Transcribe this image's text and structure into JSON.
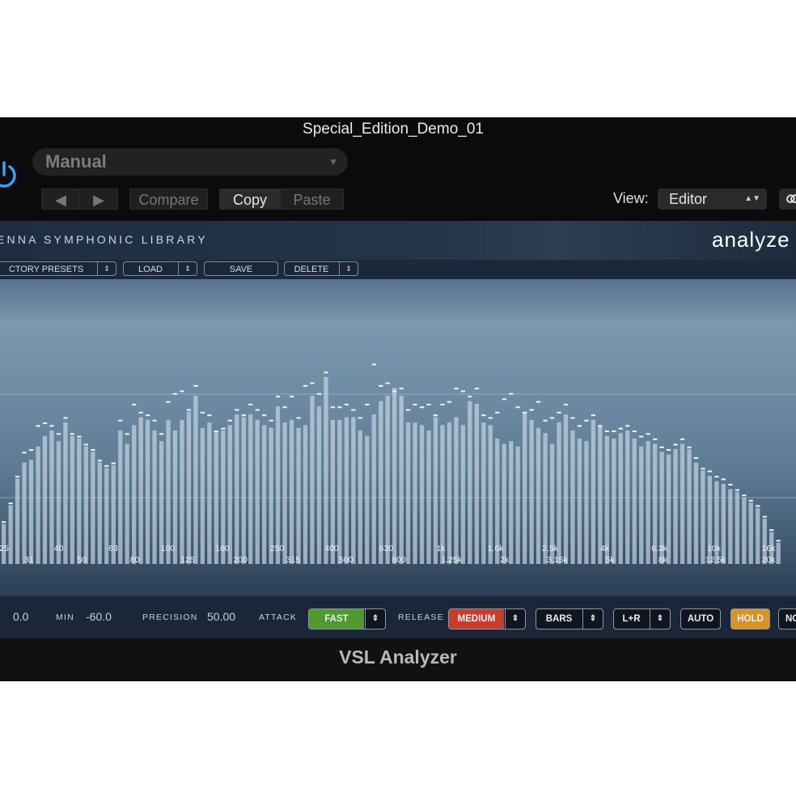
{
  "window": {
    "title": "Special_Edition_Demo_01",
    "footer_title": "VSL Analyzer"
  },
  "header": {
    "preset_value": "Manual",
    "nav_prev": "◀",
    "nav_next": "▶",
    "compare_label": "Compare",
    "copy_label": "Copy",
    "paste_label": "Paste",
    "view_label": "View:",
    "view_value": "Editor"
  },
  "plugin": {
    "brand": "ENNA SYMPHONIC LIBRARY",
    "logo": "analyze",
    "presets": {
      "factory": "CTORY PRESETS",
      "load": "LOAD",
      "save": "SAVE",
      "delete": "DELETE"
    }
  },
  "controls": {
    "max_value": "0.0",
    "min_label": "MIN",
    "min_value": "-60.0",
    "precision_label": "PRECISION",
    "precision_value": "50.00",
    "attack_label": "ATTACK",
    "attack_value": "FAST",
    "release_label": "RELEASE",
    "release_value": "MEDIUM",
    "display_mode": "BARS",
    "channel": "L+R",
    "auto_label": "AUTO",
    "hold_label": "HOLD",
    "last_label": "NO"
  },
  "colors": {
    "attack": "#4f9a30",
    "release": "#c83c2c",
    "hold": "#d59526",
    "power": "#3aa0ff"
  },
  "chart_data": {
    "type": "bar",
    "freq_labels": {
      "upper": [
        "25",
        "40",
        "63",
        "100",
        "160",
        "250",
        "400",
        "630",
        "1k",
        "1.6k",
        "2.5k",
        "4k",
        "6.3k",
        "10k",
        "16k"
      ],
      "lower": [
        "31",
        "50",
        "80",
        "125",
        "200",
        "315",
        "500",
        "800",
        "1.25k",
        "2k",
        "3.15k",
        "5k",
        "8k",
        "12.5k",
        "20k"
      ]
    },
    "ylim": [
      0,
      1
    ],
    "bars": [
      0.15,
      0.22,
      0.32,
      0.38,
      0.39,
      0.44,
      0.48,
      0.5,
      0.46,
      0.53,
      0.48,
      0.47,
      0.44,
      0.42,
      0.38,
      0.36,
      0.37,
      0.5,
      0.45,
      0.52,
      0.55,
      0.54,
      0.5,
      0.46,
      0.54,
      0.5,
      0.54,
      0.57,
      0.63,
      0.51,
      0.53,
      0.5,
      0.5,
      0.52,
      0.56,
      0.55,
      0.56,
      0.54,
      0.52,
      0.51,
      0.59,
      0.53,
      0.54,
      0.51,
      0.52,
      0.63,
      0.59,
      0.7,
      0.54,
      0.54,
      0.55,
      0.55,
      0.5,
      0.48,
      0.56,
      0.61,
      0.63,
      0.66,
      0.63,
      0.53,
      0.53,
      0.52,
      0.5,
      0.55,
      0.52,
      0.53,
      0.55,
      0.52,
      0.61,
      0.6,
      0.53,
      0.52,
      0.47,
      0.45,
      0.46,
      0.44,
      0.57,
      0.54,
      0.51,
      0.49,
      0.45,
      0.53,
      0.56,
      0.5,
      0.47,
      0.46,
      0.54,
      0.52,
      0.48,
      0.47,
      0.49,
      0.5,
      0.47,
      0.44,
      0.46,
      0.45,
      0.42,
      0.41,
      0.43,
      0.45,
      0.43,
      0.38,
      0.35,
      0.33,
      0.31,
      0.3,
      0.28,
      0.27,
      0.25,
      0.23,
      0.21,
      0.17,
      0.12,
      0.08
    ],
    "peaks": [
      0.16,
      0.23,
      0.33,
      0.42,
      0.43,
      0.52,
      0.53,
      0.52,
      0.49,
      0.55,
      0.49,
      0.48,
      0.45,
      0.43,
      0.39,
      0.37,
      0.38,
      0.54,
      0.49,
      0.6,
      0.57,
      0.56,
      0.54,
      0.49,
      0.61,
      0.64,
      0.65,
      0.58,
      0.67,
      0.57,
      0.56,
      0.5,
      0.51,
      0.54,
      0.58,
      0.56,
      0.6,
      0.58,
      0.56,
      0.54,
      0.63,
      0.59,
      0.63,
      0.55,
      0.67,
      0.68,
      0.64,
      0.72,
      0.59,
      0.59,
      0.6,
      0.58,
      0.55,
      0.6,
      0.75,
      0.67,
      0.68,
      0.65,
      0.66,
      0.58,
      0.6,
      0.59,
      0.6,
      0.56,
      0.6,
      0.61,
      0.66,
      0.65,
      0.63,
      0.66,
      0.56,
      0.55,
      0.57,
      0.62,
      0.64,
      0.59,
      0.57,
      0.58,
      0.61,
      0.54,
      0.55,
      0.57,
      0.6,
      0.55,
      0.52,
      0.54,
      0.56,
      0.52,
      0.5,
      0.5,
      0.51,
      0.52,
      0.5,
      0.48,
      0.49,
      0.47,
      0.44,
      0.43,
      0.45,
      0.47,
      0.44,
      0.4,
      0.36,
      0.35,
      0.33,
      0.32,
      0.3,
      0.28,
      0.26,
      0.24,
      0.22,
      0.18,
      0.13,
      0.09
    ]
  }
}
